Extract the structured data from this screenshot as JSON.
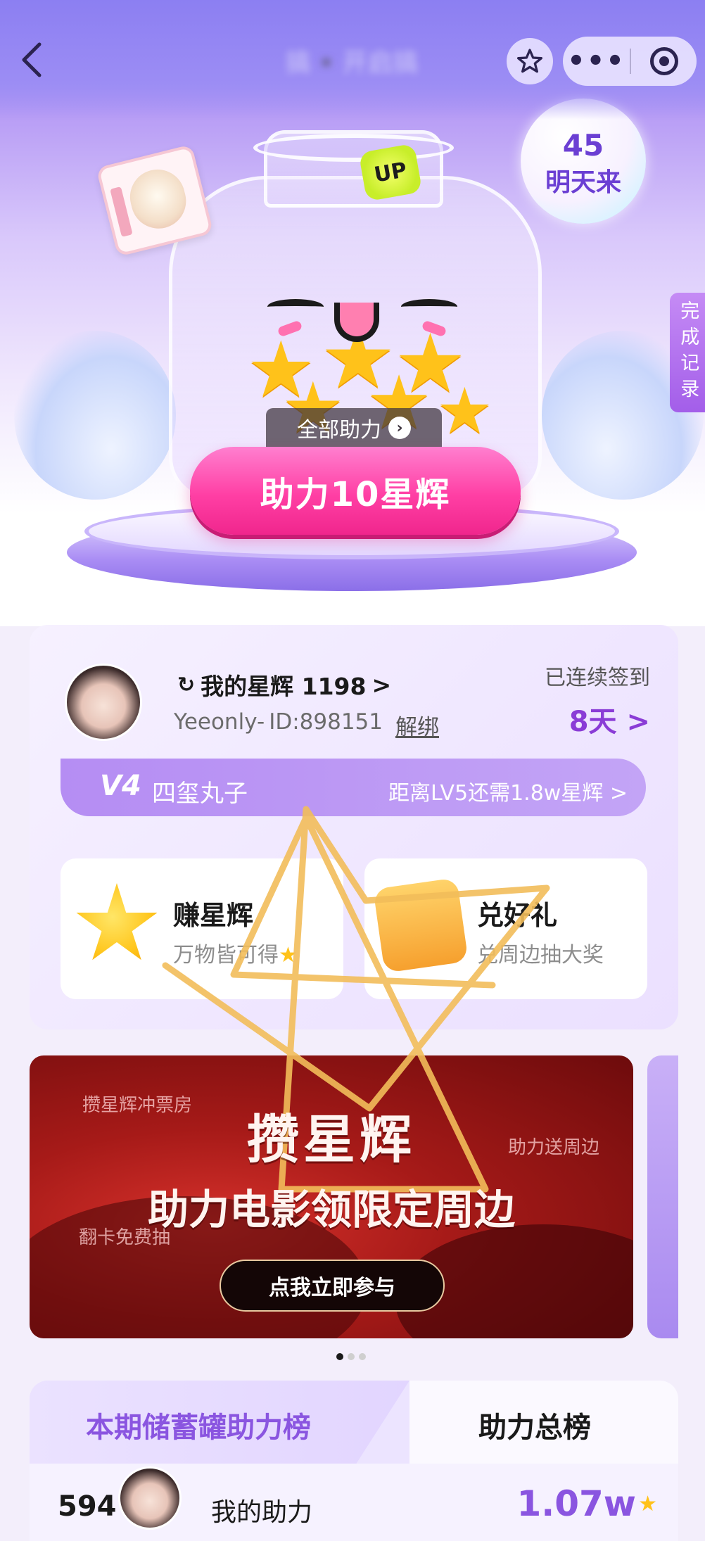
{
  "nav": {
    "back_icon": "chevron-left-icon",
    "title": "搞▪️开启搞",
    "favorite_icon": "star-outline-icon",
    "more_icon": "more-dots-icon",
    "close_icon": "target-circle-icon"
  },
  "hero": {
    "bubble_number": "45",
    "bubble_text": "明天来",
    "record_tab": "完成记录",
    "up_badge": "UP",
    "all_help_label": "全部助力",
    "help_button_label": "助力10星辉"
  },
  "profile": {
    "points_label": "我的星辉 1198",
    "points_arrow": ">",
    "username": "Yeeonly-",
    "user_id": "ID:898151",
    "unbind_label": "解绑",
    "signed_label": "已连续签到",
    "signed_days": "8天 >",
    "level": "V4",
    "level_name": "四玺丸子",
    "next_level_text": "距离LV5还需1.8w星辉 >"
  },
  "tasks": [
    {
      "title": "赚星辉",
      "subtitle": "万物皆可得",
      "icon": "star-mascot-icon"
    },
    {
      "title": "兑好礼",
      "subtitle": "兑周边抽大奖",
      "icon": "gift-box-icon"
    }
  ],
  "banner": {
    "corner_tl": "攒星辉冲票房",
    "corner_tr": "助力送周边",
    "corner_bl": "翻卡免费抽",
    "headline": "攒星辉",
    "subheadline": "助力电影领限定周边",
    "join_label": "点我立即参与",
    "page_index": 1,
    "page_count": 3
  },
  "ranking": {
    "tab_current": "本期储蓄罐助力榜",
    "tab_total": "助力总榜",
    "my_rank": "594",
    "my_label": "我的助力",
    "my_value": "1.07w"
  },
  "colors": {
    "accent_purple": "#8a55e0",
    "pink_button": "#ff3fa4",
    "banner_red": "#a61a18"
  }
}
